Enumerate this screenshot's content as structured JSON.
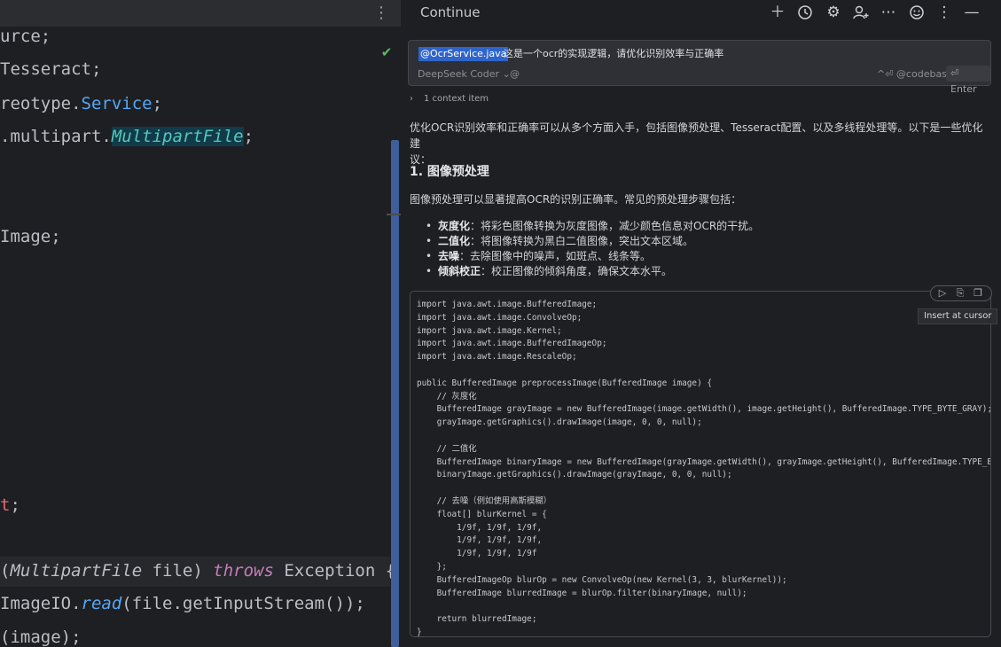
{
  "editor": {
    "menu_icon": "⋮",
    "lines": [
      {
        "text": "urce;"
      },
      {
        "text": "Tesseract;"
      },
      {
        "pre": "reotype.",
        "cyan": "Service",
        "post": ";"
      },
      {
        "pre": ".multipart.",
        "hl": "MultipartFile",
        "post": ";"
      },
      {
        "text": "Image;"
      },
      {
        "text": "t;"
      },
      {
        "paren": "(",
        "type": "MultipartFile",
        "mid": " file)",
        "throws": "throws",
        "exc": " Exception {"
      },
      {
        "pre2": "ImageIO.",
        "method": "read",
        "post2": "(file.getInputStream());"
      },
      {
        "text": "(image);"
      }
    ]
  },
  "panel": {
    "title": "Continue",
    "icons": [
      "plus-icon",
      "history-icon",
      "settings-icon",
      "user-add-icon",
      "more-icon",
      "smile-icon",
      "kebab-icon",
      "minimize-icon"
    ],
    "input": {
      "mention": "@OcrService.java",
      "text": "这是一个ocr的实现逻辑，请优化识别效率与正确率",
      "model": "DeepSeek Coder",
      "at": "@",
      "codebase": "^⏎ @codebase",
      "enter": "⏎ Enter"
    },
    "context": "1 context item",
    "intro": "优化OCR识别效率和正确率可以从多个方面入手，包括图像预处理、Tesseract配置、以及多线程处理等。以下是一些优化建议：",
    "intro_line1": "优化OCR识别效率和正确率可以从多个方面入手，包括图像预处理、Tesseract配置、以及多线程处理等。以下是一些优化建",
    "intro_line2": "议：",
    "heading": "1. 图像预处理",
    "sub": "图像预处理可以显著提高OCR的识别正确率。常见的预处理步骤包括：",
    "bullets": [
      {
        "term": "灰度化",
        "desc": "：将彩色图像转换为灰度图像，减少颜色信息对OCR的干扰。"
      },
      {
        "term": "二值化",
        "desc": "：将图像转换为黑白二值图像，突出文本区域。"
      },
      {
        "term": "去噪",
        "desc": "：去除图像中的噪声，如斑点、线条等。"
      },
      {
        "term": "倾斜校正",
        "desc": "：校正图像的倾斜角度，确保文本水平。"
      }
    ],
    "tooltip": "Insert at cursor",
    "code": "import java.awt.image.BufferedImage;\nimport java.awt.image.ConvolveOp;\nimport java.awt.image.Kernel;\nimport java.awt.image.BufferedImageOp;\nimport java.awt.image.RescaleOp;\n\npublic BufferedImage preprocessImage(BufferedImage image) {\n    // 灰度化\n    BufferedImage grayImage = new BufferedImage(image.getWidth(), image.getHeight(), BufferedImage.TYPE_BYTE_GRAY);\n    grayImage.getGraphics().drawImage(image, 0, 0, null);\n\n    // 二值化\n    BufferedImage binaryImage = new BufferedImage(grayImage.getWidth(), grayImage.getHeight(), BufferedImage.TYPE_BYTE_BINARY);\n    binaryImage.getGraphics().drawImage(grayImage, 0, 0, null);\n\n    // 去噪（例如使用高斯模糊）\n    float[] blurKernel = {\n        1/9f, 1/9f, 1/9f,\n        1/9f, 1/9f, 1/9f,\n        1/9f, 1/9f, 1/9f\n    };\n    BufferedImageOp blurOp = new ConvolveOp(new Kernel(3, 3, blurKernel));\n    BufferedImage blurredImage = blurOp.filter(binaryImage, null);\n\n    return blurredImage;\n}"
  }
}
